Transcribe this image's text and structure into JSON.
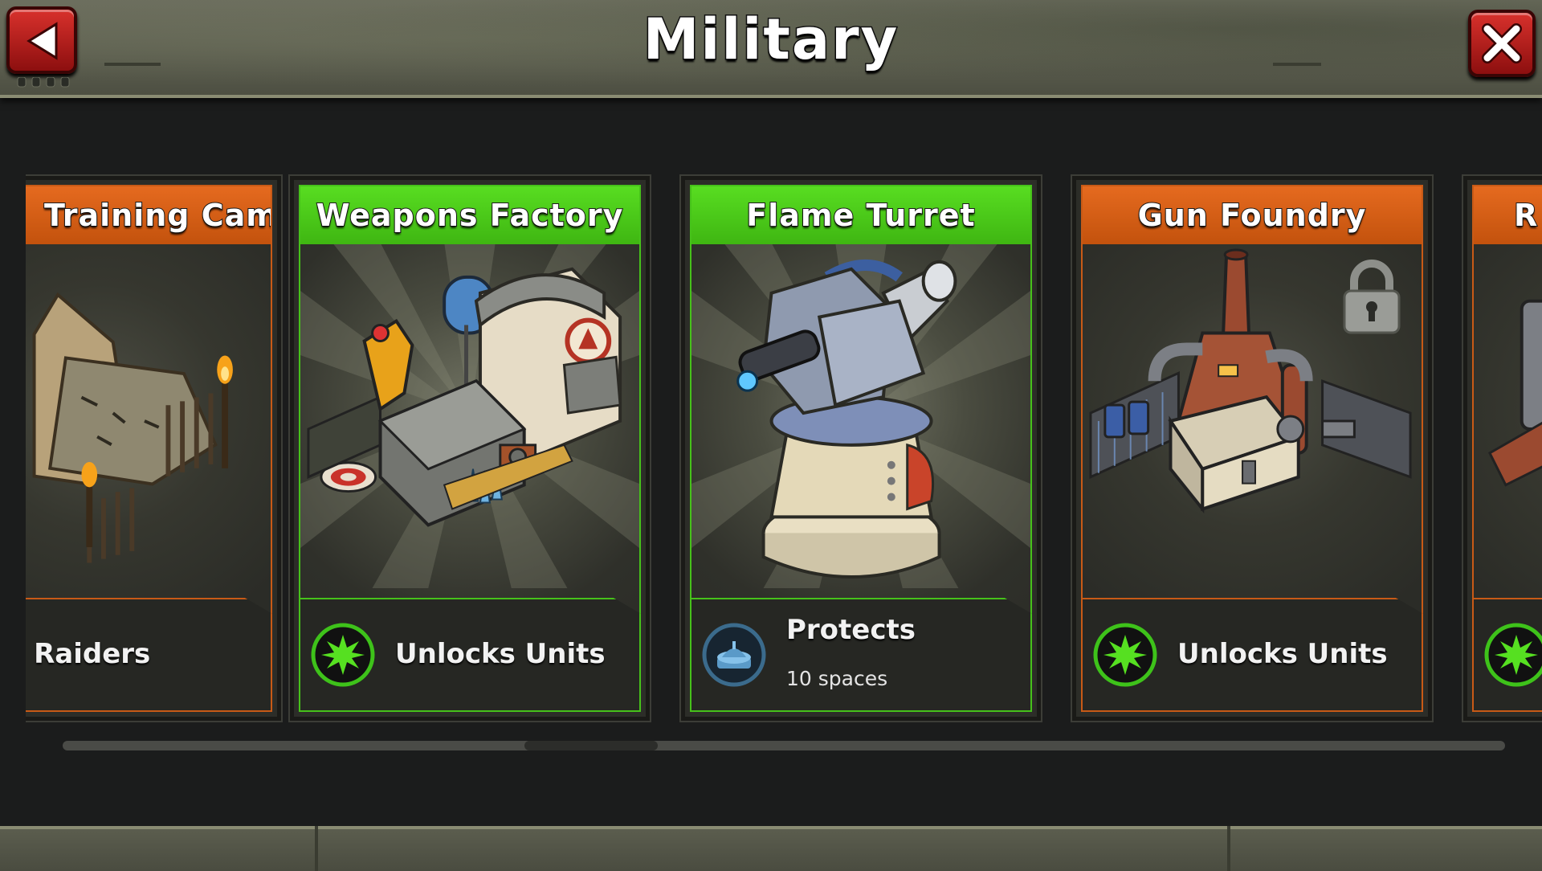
{
  "header": {
    "title": "Military"
  },
  "cards": [
    {
      "id": "training-camp",
      "name": "Training Camp",
      "theme": "orange",
      "info_icon": "green-starburst-icon",
      "info_text": "Trains Raiders",
      "info_sub": "",
      "locked": false
    },
    {
      "id": "weapons-factory",
      "name": "Weapons Factory",
      "theme": "green",
      "info_icon": "green-starburst-icon",
      "info_text": "Unlocks Units",
      "info_sub": "",
      "locked": false
    },
    {
      "id": "flame-turret",
      "name": "Flame Turret",
      "theme": "green",
      "info_icon": "defense-dome-icon",
      "info_text": "Protects",
      "info_sub": "10 spaces",
      "locked": false
    },
    {
      "id": "gun-foundry",
      "name": "Gun Foundry",
      "theme": "orange",
      "info_icon": "green-starburst-icon",
      "info_text": "Unlocks Units",
      "info_sub": "",
      "locked": true
    },
    {
      "id": "partial-card",
      "name": "R",
      "theme": "orange",
      "info_icon": "green-starburst-icon",
      "info_text": "",
      "info_sub": "",
      "locked": false
    }
  ],
  "scrollbar": {
    "position_fraction": 0.32
  },
  "colors": {
    "green_accent": "#46c21a",
    "orange_accent": "#c85a16",
    "button_red": "#c82620",
    "background": "#1b1c1c"
  }
}
